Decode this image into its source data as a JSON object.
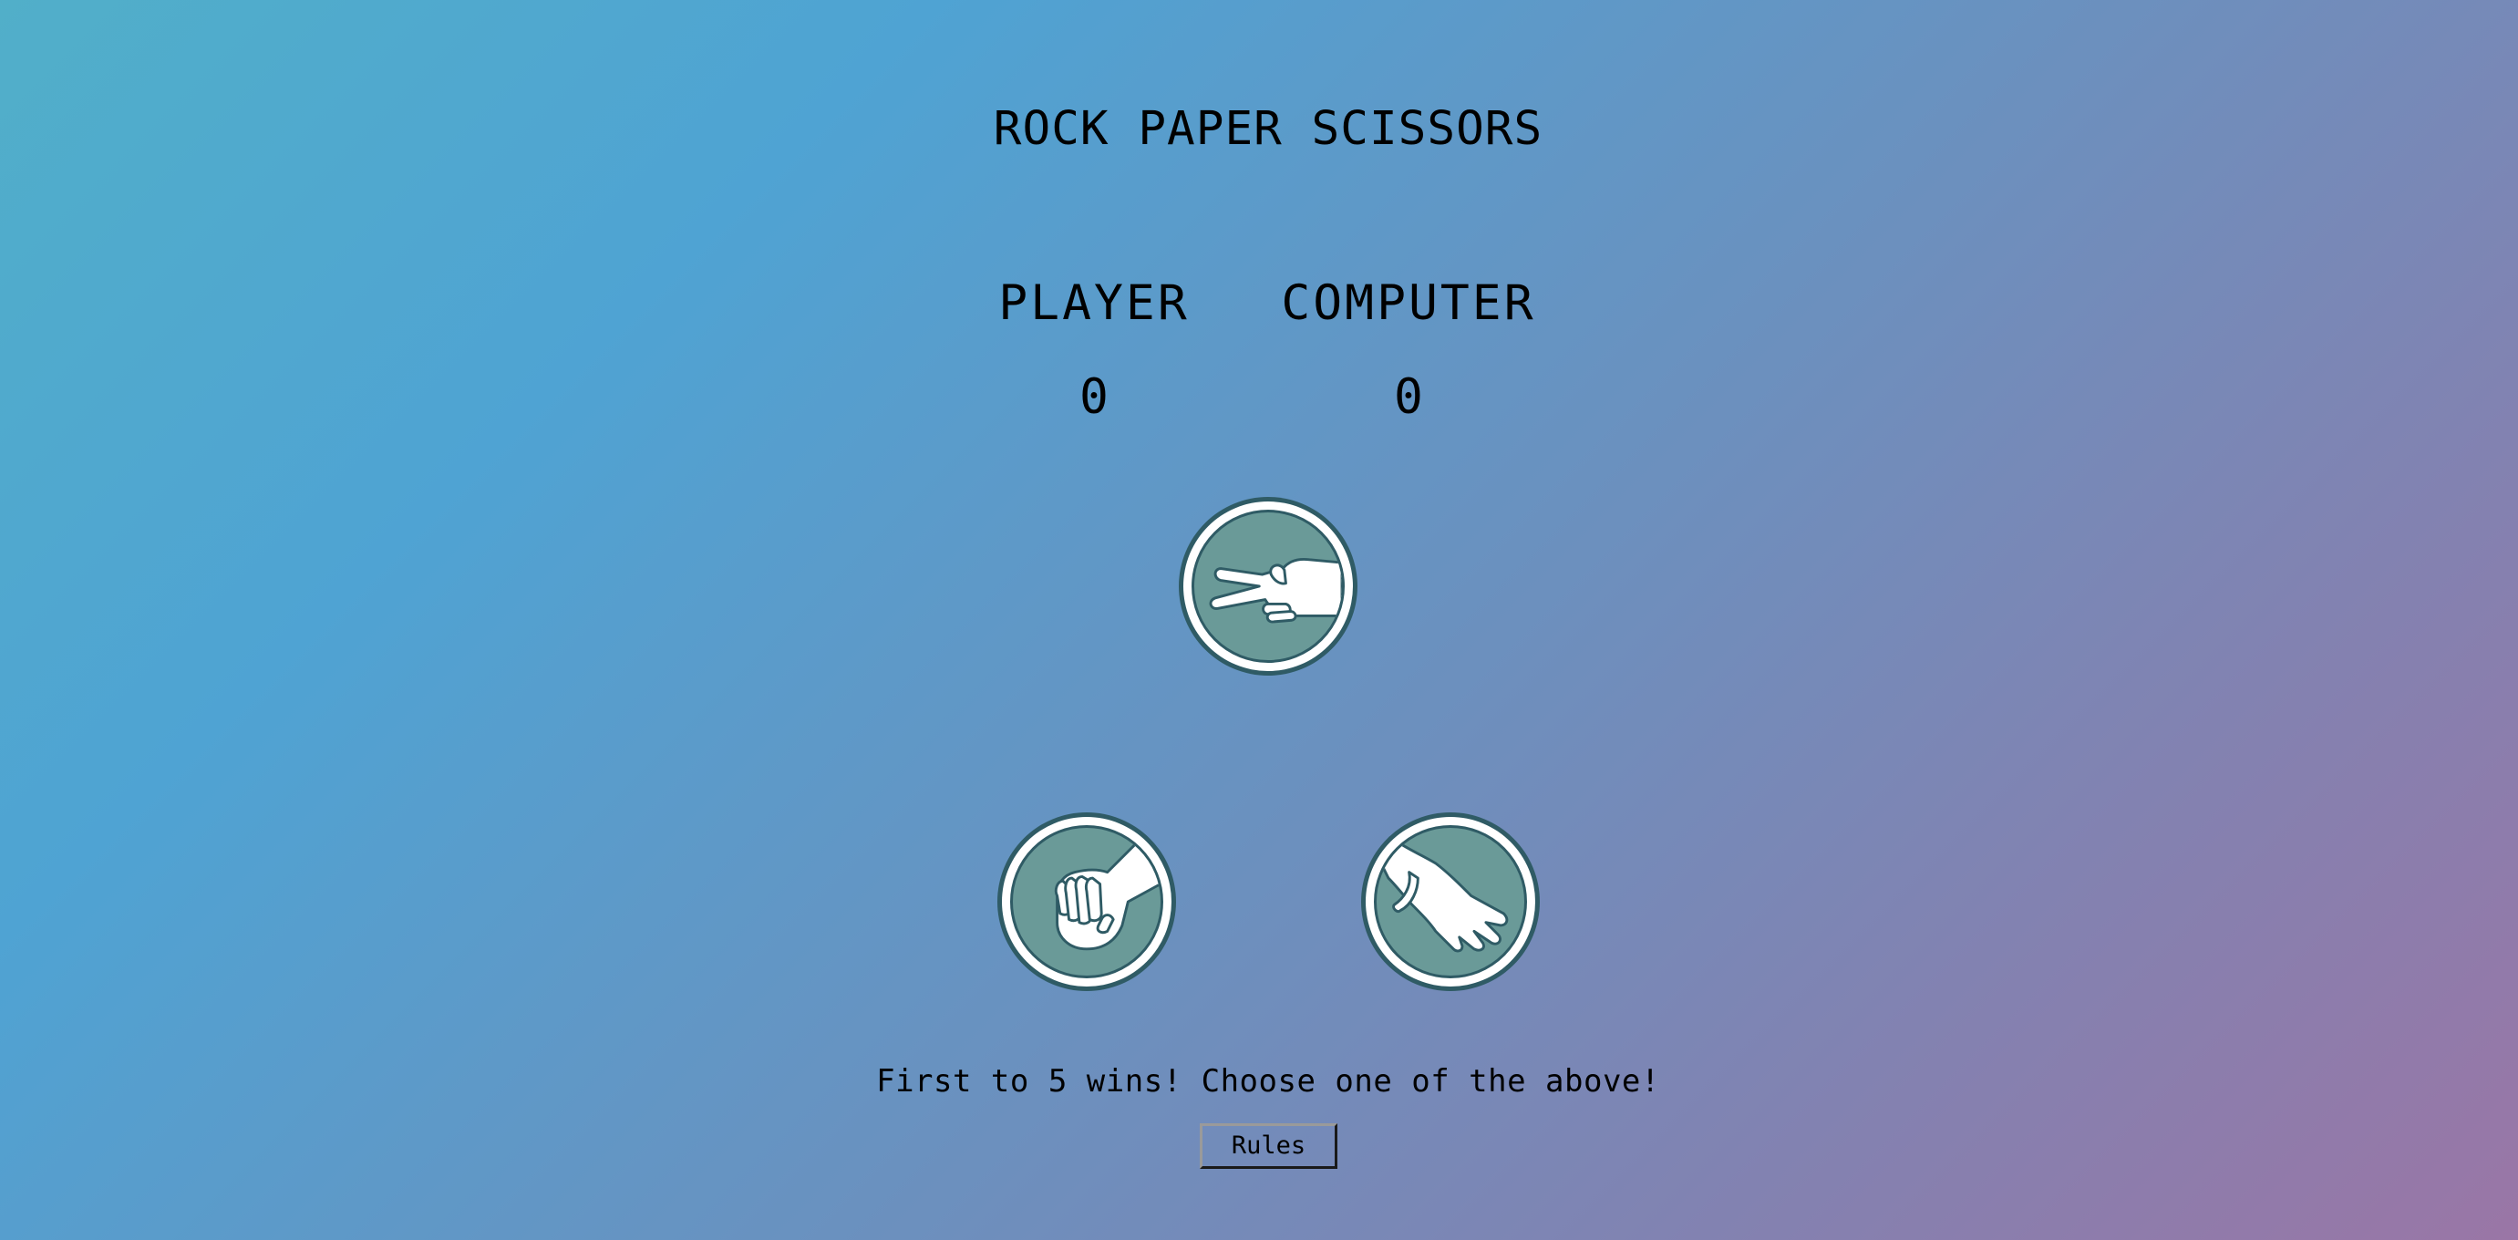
{
  "app": {
    "title": "ROCK PAPER SCISSORS"
  },
  "scoreboard": {
    "player_label": "PLAYER",
    "computer_label": "COMPUTER",
    "player_score": "0",
    "computer_score": "0"
  },
  "choices": [
    {
      "id": "scissors",
      "icon": "scissors-hand-icon"
    },
    {
      "id": "rock",
      "icon": "rock-fist-icon"
    },
    {
      "id": "paper",
      "icon": "paper-hand-icon"
    }
  ],
  "footer": {
    "instructions": "First to 5 wins! Choose one of the above!",
    "rules_button": "Rules"
  },
  "colors": {
    "circle_fill": "#6a9a98",
    "circle_border": "#2f5b65",
    "hand": "#ffffff"
  }
}
